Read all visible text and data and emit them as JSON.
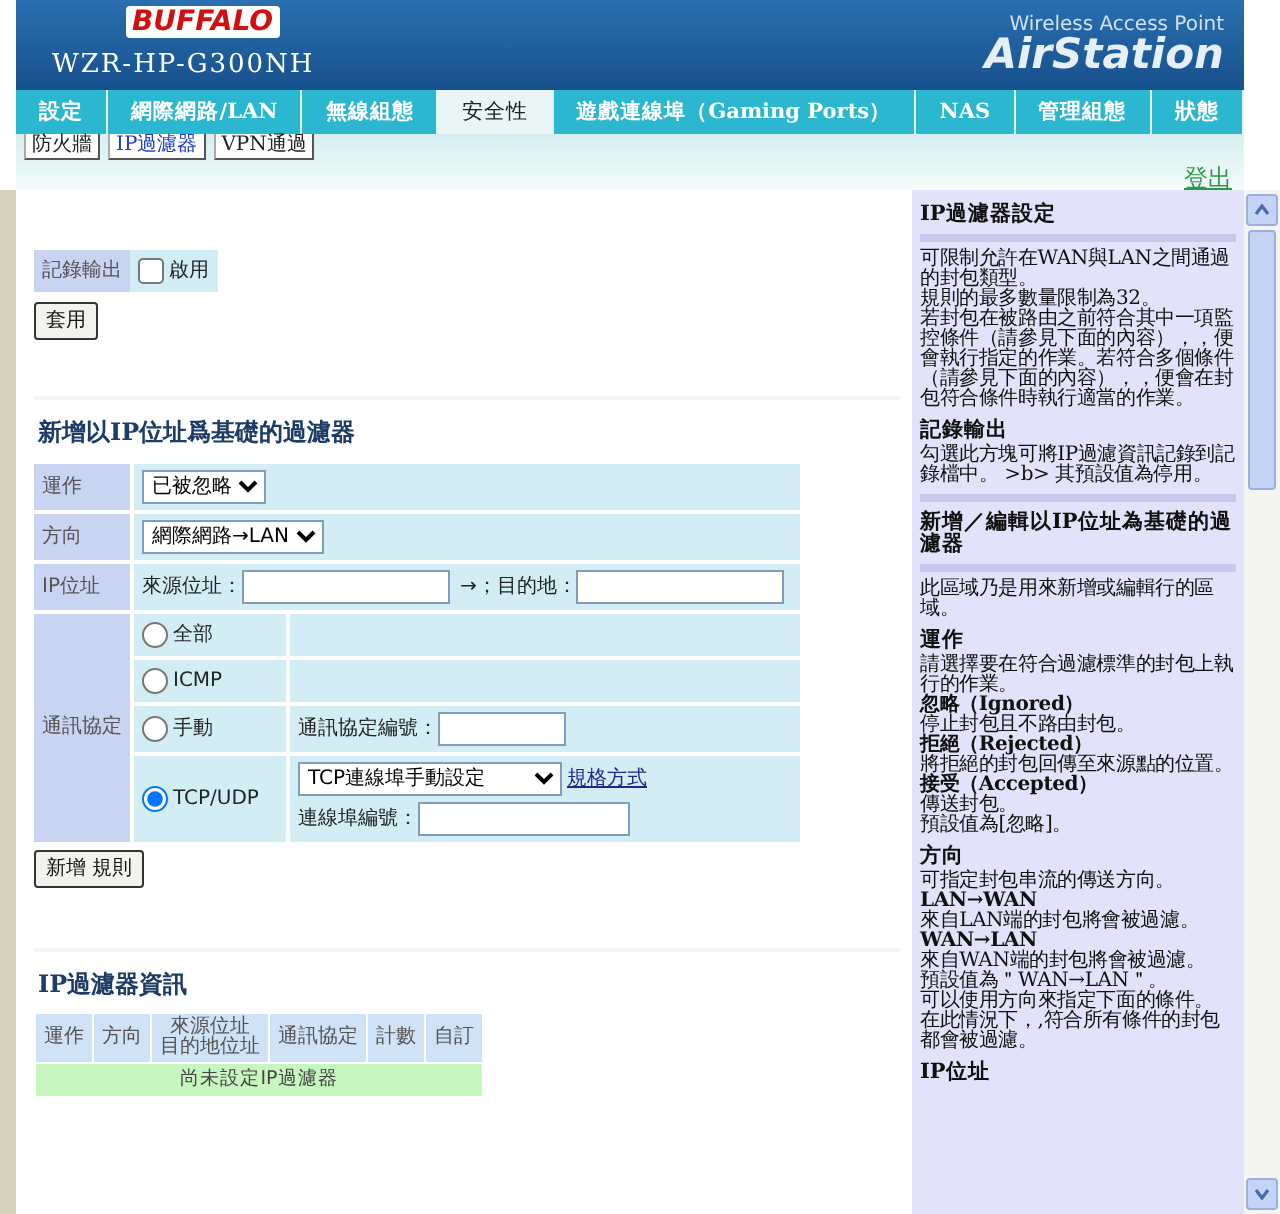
{
  "header": {
    "brand": "BUFFALO",
    "model": "WZR-HP-G300NH",
    "tagline": "Wireless Access Point",
    "product": "AirStation"
  },
  "nav_tabs": [
    {
      "label": "設定",
      "selected": false
    },
    {
      "label": "網際網路/LAN",
      "selected": false
    },
    {
      "label": "無線組態",
      "selected": false
    },
    {
      "label": "安全性",
      "selected": true
    },
    {
      "label": "遊戲連線埠（Gaming Ports）",
      "selected": false
    },
    {
      "label": "NAS",
      "selected": false
    },
    {
      "label": "管理組態",
      "selected": false
    },
    {
      "label": "狀態",
      "selected": false
    }
  ],
  "sub_tabs": [
    {
      "label": "防火牆",
      "selected": false
    },
    {
      "label": "IP過濾器",
      "selected": true
    },
    {
      "label": "VPN通過",
      "selected": false
    }
  ],
  "logout": "登出",
  "log_output": {
    "label": "記錄輸出",
    "option": "啟用",
    "checked": false
  },
  "apply_button": "套用",
  "add_filter": {
    "title": "新增以IP位址爲基礎的過濾器",
    "operation": {
      "label": "運作",
      "value": "已被忽略"
    },
    "direction": {
      "label": "方向",
      "value": "網際網路→LAN"
    },
    "ip_address": {
      "label": "IP位址",
      "source_label": "來源位址：",
      "destination_label": "→；目的地："
    },
    "protocol": {
      "label": "通訊協定",
      "options": [
        {
          "label": "全部",
          "selected": false,
          "kind": "plain"
        },
        {
          "label": "ICMP",
          "selected": false,
          "kind": "plain"
        },
        {
          "label": "手動",
          "selected": false,
          "kind": "number",
          "field_label": "通訊協定編號："
        },
        {
          "label": "TCP/UDP",
          "selected": true,
          "kind": "port",
          "port_select": "TCP連線埠手動設定",
          "link": "規格方式",
          "field_label": "連線埠編號："
        }
      ]
    }
  },
  "add_button": "新增 規則",
  "filter_info": {
    "title": "IP過濾器資訊",
    "columns": [
      [
        "運作"
      ],
      [
        "方向"
      ],
      [
        "來源位址",
        "目的地位址"
      ],
      [
        "通訊協定"
      ],
      [
        "計數"
      ],
      [
        "自訂"
      ]
    ],
    "empty_message": "尚未設定IP過濾器"
  },
  "help": [
    {
      "kind": "group",
      "title": "IP過濾器設定",
      "lines": [
        {
          "kind": "plain",
          "text": "可限制允許在WAN與LAN之間通過的封包類型。"
        },
        {
          "kind": "plain",
          "text": "規則的最多數量限制為32。"
        },
        {
          "kind": "plain",
          "text": "若封包在被路由之前符合其中一項監控條件（請參見下面的內容），，便會執行指定的作業。若符合多個條件（請參見下面的內容），，便會在封包符合條件時執行適當的作業。"
        }
      ]
    },
    {
      "kind": "item",
      "title": "記錄輸出",
      "lines": [
        {
          "kind": "plain",
          "text": "勾選此方塊可將IP過濾資訊記錄到記錄檔中。 >b> 其預設值為停用。"
        }
      ]
    },
    {
      "kind": "group",
      "title": "新增／編輯以IP位址為基礎的過濾器",
      "lines": [
        {
          "kind": "plain",
          "text": "此區域乃是用來新增或編輯行的區域。"
        }
      ]
    },
    {
      "kind": "item",
      "title": "運作",
      "lines": [
        {
          "kind": "plain",
          "text": "請選擇要在符合過濾標準的封包上執行的作業。"
        },
        {
          "kind": "term",
          "text": "忽略（Ignored）"
        },
        {
          "kind": "plain",
          "text": "停止封包且不路由封包。"
        },
        {
          "kind": "term",
          "text": "拒絕（Rejected）"
        },
        {
          "kind": "plain",
          "text": "將拒絕的封包回傳至來源點的位置。"
        },
        {
          "kind": "term",
          "text": "接受（Accepted）"
        },
        {
          "kind": "plain",
          "text": "傳送封包。"
        },
        {
          "kind": "plain",
          "text": "預設值為[忽略]。"
        }
      ]
    },
    {
      "kind": "item",
      "title": "方向",
      "lines": [
        {
          "kind": "plain",
          "text": "可指定封包串流的傳送方向。"
        },
        {
          "kind": "term",
          "text": "LAN→WAN"
        },
        {
          "kind": "plain",
          "text": "來自LAN端的封包將會被過濾。"
        },
        {
          "kind": "term",
          "text": "WAN→LAN"
        },
        {
          "kind": "plain",
          "text": "來自WAN端的封包將會被過濾。"
        },
        {
          "kind": "plain",
          "text": "預設值為＂WAN→LAN＂。"
        },
        {
          "kind": "plain",
          "text": "可以使用方向來指定下面的條件。"
        },
        {
          "kind": "plain",
          "text": "在此情況下，,符合所有條件的封包都會被過濾。"
        }
      ]
    },
    {
      "kind": "item",
      "title": "IP位址"
    }
  ]
}
